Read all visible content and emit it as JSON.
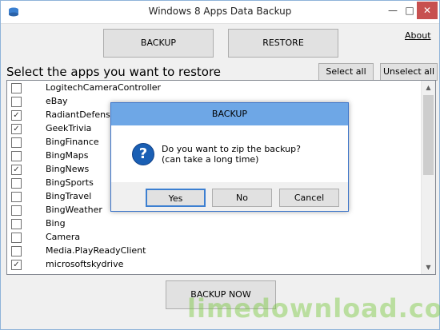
{
  "window": {
    "title": "Windows 8 Apps Data Backup",
    "minimize_glyph": "—",
    "maximize_glyph": "□",
    "close_glyph": "✕"
  },
  "toolbar": {
    "backup_label": "BACKUP",
    "restore_label": "RESTORE",
    "about_label": "About"
  },
  "select": {
    "label": "Select the apps you want to restore",
    "select_all": "Select all",
    "unselect_all": "Unselect all"
  },
  "apps": [
    {
      "name": "LogitechCameraController",
      "checked": false
    },
    {
      "name": "eBay",
      "checked": false
    },
    {
      "name": "RadiantDefense",
      "checked": true
    },
    {
      "name": "GeekTrivia",
      "checked": true
    },
    {
      "name": "BingFinance",
      "checked": false
    },
    {
      "name": "BingMaps",
      "checked": false
    },
    {
      "name": "BingNews",
      "checked": true
    },
    {
      "name": "BingSports",
      "checked": false
    },
    {
      "name": "BingTravel",
      "checked": false
    },
    {
      "name": "BingWeather",
      "checked": false
    },
    {
      "name": "Bing",
      "checked": false
    },
    {
      "name": "Camera",
      "checked": false
    },
    {
      "name": "Media.PlayReadyClient",
      "checked": false
    },
    {
      "name": "microsoftskydrive",
      "checked": true
    }
  ],
  "footer": {
    "backup_now": "BACKUP NOW"
  },
  "dialog": {
    "title": "BACKUP",
    "line1": "Do you want to zip the backup?",
    "line2": "(can take a long time)",
    "yes": "Yes",
    "no": "No",
    "cancel": "Cancel"
  },
  "watermark": "limedownload.com",
  "colors": {
    "dialog_title_bg": "#6ea7e6",
    "close_button": "#c75050",
    "watermark": "#78c83c"
  }
}
